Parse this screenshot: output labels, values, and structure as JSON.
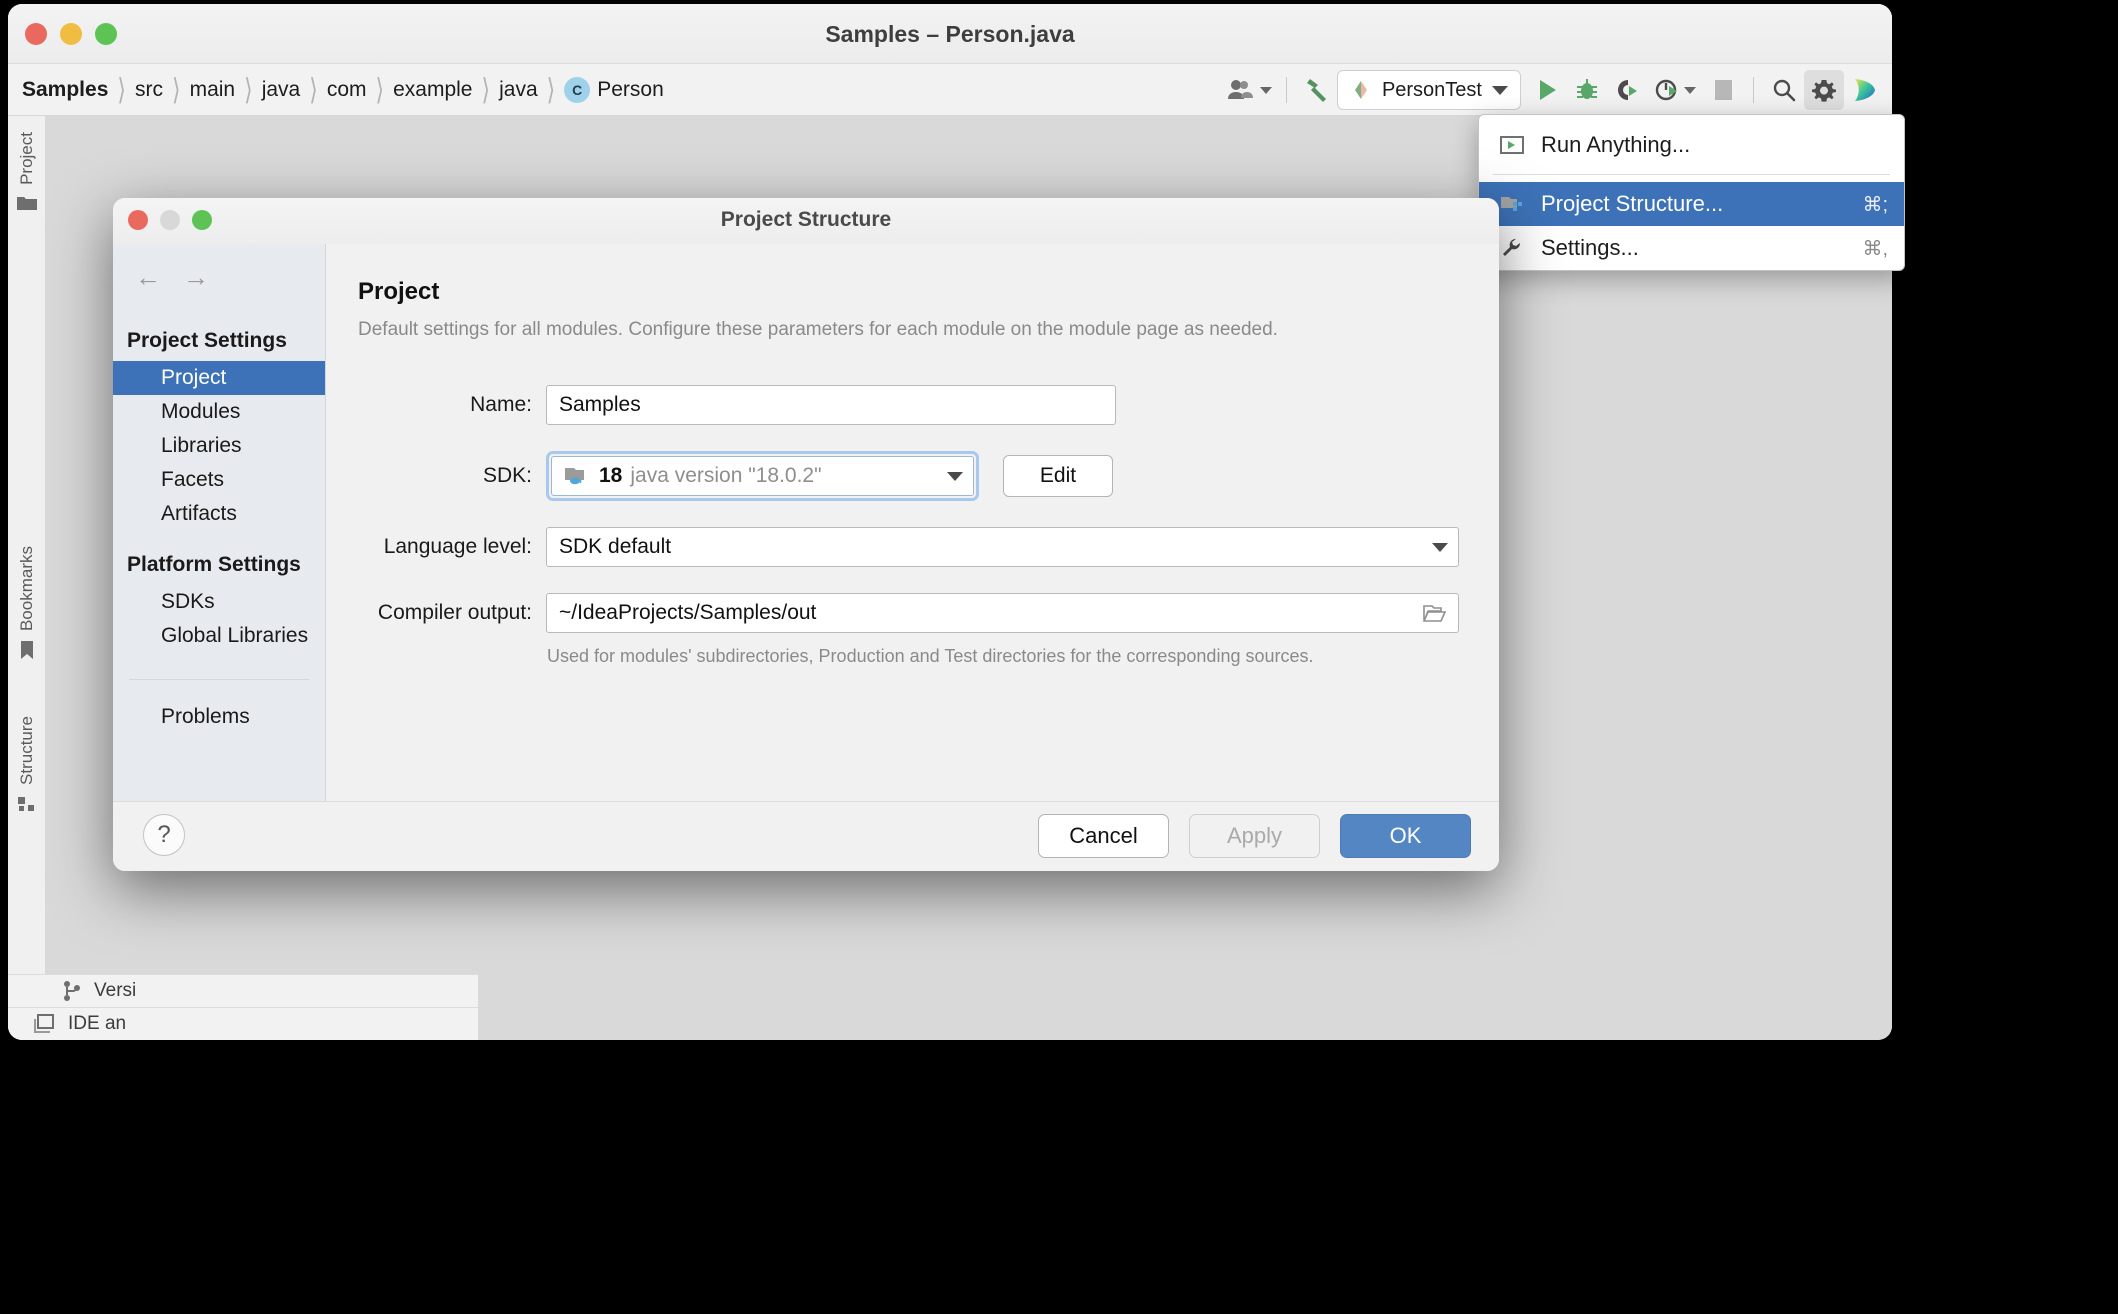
{
  "ide": {
    "window_title": "Samples – Person.java",
    "breadcrumb": [
      {
        "label": "Samples",
        "bold": true
      },
      {
        "label": "src",
        "bold": false
      },
      {
        "label": "main",
        "bold": false
      },
      {
        "label": "java",
        "bold": false
      },
      {
        "label": "com",
        "bold": false
      },
      {
        "label": "example",
        "bold": false
      },
      {
        "label": "java",
        "bold": false
      }
    ],
    "breadcrumb_class": {
      "icon_letter": "C",
      "label": "Person",
      "icon_name": "java-class-icon"
    },
    "toolbar": {
      "profile_icon": "user-profile-icon",
      "build_icon": "hammer-build-icon",
      "run_config": "PersonTest",
      "run_icon": "run-icon",
      "debug_icon": "debug-bug-icon",
      "coverage_icon": "run-with-coverage-icon",
      "profiler_icon": "profiler-icon",
      "stop_icon": "stop-icon",
      "search_icon": "search-icon",
      "settings_icon": "gear-settings-icon",
      "ide_services_icon": "ide-services-icon"
    },
    "tool_rail": [
      {
        "label": "Project",
        "icon": "project-folder-icon"
      },
      {
        "label": "Bookmarks",
        "icon": "bookmark-icon"
      },
      {
        "label": "Structure",
        "icon": "structure-icon"
      }
    ],
    "bottom_rail": [
      {
        "label": "Versi",
        "icon": "version-control-icon"
      },
      {
        "label": "IDE an",
        "icon": "ide-updates-icon"
      }
    ]
  },
  "gear_menu": {
    "items": [
      {
        "label": "Run Anything...",
        "shortcut": "",
        "icon": "run-anything-icon",
        "selected": false
      },
      {
        "label": "Project Structure...",
        "shortcut": "⌘;",
        "icon": "project-structure-icon",
        "selected": true
      },
      {
        "label": "Settings...",
        "shortcut": "⌘,",
        "icon": "wrench-settings-icon",
        "selected": false
      }
    ]
  },
  "dialog": {
    "title": "Project Structure",
    "nav": {
      "back": "←",
      "forward": "→"
    },
    "sidebar": {
      "project_settings_header": "Project Settings",
      "project_items": [
        "Project",
        "Modules",
        "Libraries",
        "Facets",
        "Artifacts"
      ],
      "selected_item": "Project",
      "platform_settings_header": "Platform Settings",
      "platform_items": [
        "SDKs",
        "Global Libraries"
      ],
      "extra_items": [
        "Problems"
      ]
    },
    "content": {
      "heading": "Project",
      "subheading": "Default settings for all modules. Configure these parameters for each module on the module page as needed.",
      "name_label": "Name:",
      "name_value": "Samples",
      "sdk_label": "SDK:",
      "sdk_number": "18",
      "sdk_version": "java version \"18.0.2\"",
      "edit_button": "Edit",
      "language_level_label": "Language level:",
      "language_level_value": "SDK default",
      "compiler_output_label": "Compiler output:",
      "compiler_output_value": "~/IdeaProjects/Samples/out",
      "compiler_hint": "Used for modules' subdirectories, Production and Test directories for the corresponding sources."
    },
    "footer": {
      "help": "?",
      "cancel": "Cancel",
      "apply": "Apply",
      "ok": "OK"
    }
  },
  "colors": {
    "accent_blue": "#3d72b8",
    "ok_button": "#5586c4",
    "sidebar_bg": "#e7eaee",
    "dialog_bg": "#f1f1f1"
  }
}
